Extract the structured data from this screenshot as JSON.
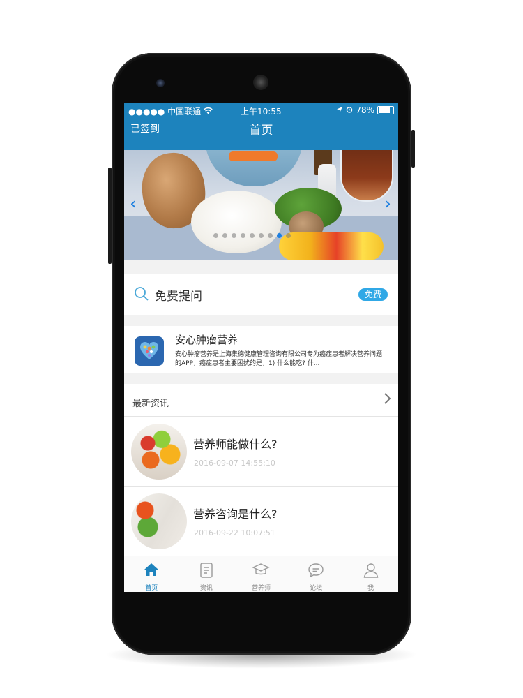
{
  "status_bar": {
    "carrier": "●●●●● 中国联通",
    "time": "上午10:55",
    "battery": "78%",
    "battery_level": 0.78
  },
  "header": {
    "left_label": "已签到",
    "title": "首页"
  },
  "banner": {
    "slide_count": 9,
    "active_index": 7
  },
  "ask": {
    "label": "免费提问",
    "badge": "免费"
  },
  "app_card": {
    "name": "安心肿瘤营养",
    "description": "安心肿瘤营养是上海集德健康管理咨询有限公司专为癌症患者解决营养问题的APP，癌症患者主要困扰的是，1) 什么能吃? 什..."
  },
  "news": {
    "section_title": "最新资讯",
    "items": [
      {
        "title": "营养师能做什么?",
        "date": "2016-09-07 14:55:10"
      },
      {
        "title": "营养咨询是什么?",
        "date": "2016-09-22 10:07:51"
      }
    ]
  },
  "tabs": [
    {
      "label": "首页",
      "icon": "home-icon",
      "active": true
    },
    {
      "label": "资讯",
      "icon": "news-icon",
      "active": false
    },
    {
      "label": "营养师",
      "icon": "graduation-cap-icon",
      "active": false
    },
    {
      "label": "论坛",
      "icon": "chat-icon",
      "active": false
    },
    {
      "label": "我",
      "icon": "user-icon",
      "active": false
    }
  ],
  "colors": {
    "brand_blue": "#1d83bd",
    "badge_blue": "#30a8e6",
    "active_dot": "#1d7fe0"
  }
}
